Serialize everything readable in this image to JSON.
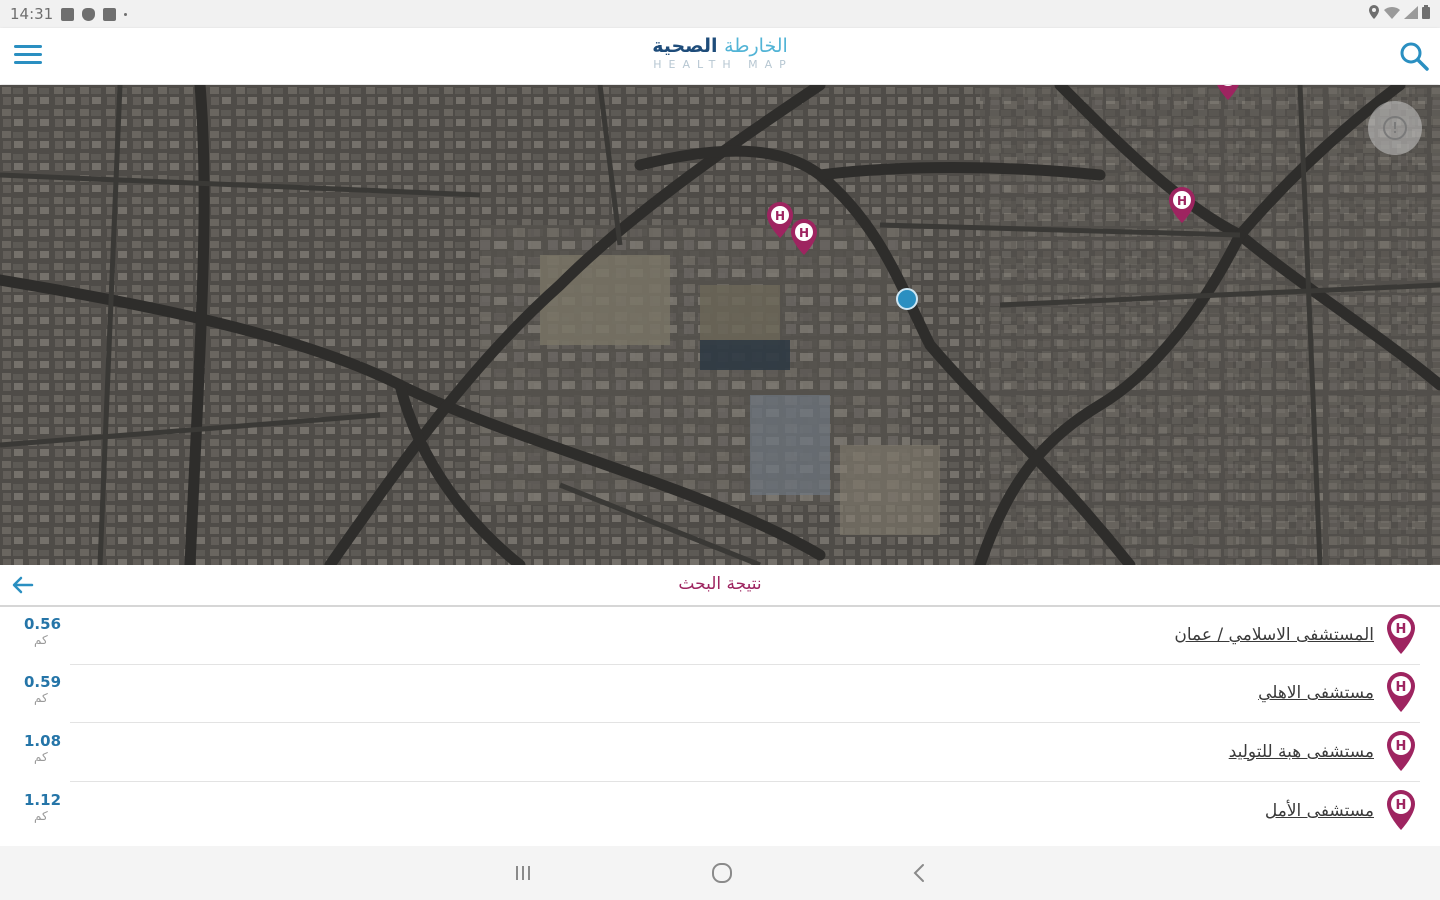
{
  "status_bar": {
    "time": "14:31"
  },
  "app_bar": {
    "logo_arabic_part1": "الخارطة",
    "logo_arabic_part2": "الصحية",
    "logo_english": "HEALTH MAP",
    "menu_icon": "hamburger-menu-icon",
    "search_icon": "search-icon"
  },
  "map": {
    "style": "satellite",
    "info_icon": "info-icon",
    "pin_color": "#9e2460",
    "location_color": "#2a8fc1"
  },
  "results": {
    "title": "نتيجة البحث",
    "back_icon": "arrow-left-icon",
    "items": [
      {
        "name": "المستشفى الاسلامي / عمان",
        "distance": "0.56",
        "unit": "كم"
      },
      {
        "name": "مستشفى الاهلي",
        "distance": "0.59",
        "unit": "كم"
      },
      {
        "name": "مستشفى هبة للتوليد",
        "distance": "1.08",
        "unit": "كم"
      },
      {
        "name": "مستشفى الأمل",
        "distance": "1.12",
        "unit": "كم"
      }
    ]
  },
  "nav_bar": {
    "recents_icon": "recents-icon",
    "home_icon": "home-icon",
    "back_icon": "back-chevron-icon"
  },
  "colors": {
    "brand_blue": "#2a8fc1",
    "brand_dark_blue": "#1e4c7a",
    "accent_magenta": "#9e2460",
    "distance_blue": "#2575a8"
  }
}
